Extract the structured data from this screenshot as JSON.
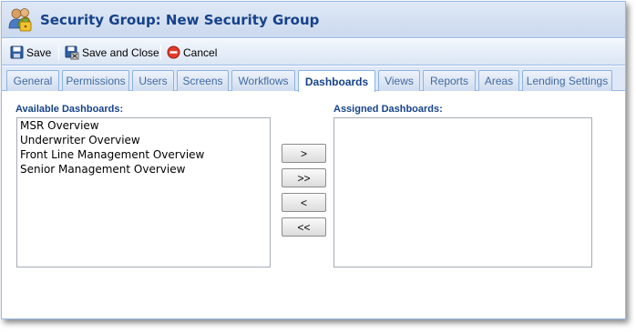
{
  "window": {
    "title": "Security Group: New Security Group",
    "title_icon": "security-group-icon"
  },
  "toolbar": {
    "save_label": "Save",
    "save_close_label": "Save and Close",
    "cancel_label": "Cancel"
  },
  "tabs": [
    {
      "label": "General"
    },
    {
      "label": "Permissions"
    },
    {
      "label": "Users"
    },
    {
      "label": "Screens"
    },
    {
      "label": "Workflows"
    },
    {
      "label": "Dashboards",
      "active": true
    },
    {
      "label": "Views"
    },
    {
      "label": "Reports"
    },
    {
      "label": "Areas"
    },
    {
      "label": "Lending Settings"
    }
  ],
  "available": {
    "label": "Available Dashboards:",
    "items": [
      "MSR Overview",
      "Underwriter Overview",
      "Front Line Management Overview",
      "Senior Management Overview"
    ]
  },
  "assigned": {
    "label": "Assigned Dashboards:",
    "items": []
  },
  "move_buttons": {
    "add_one": ">",
    "add_all": ">>",
    "remove_one": "<",
    "remove_all": "<<"
  },
  "colors": {
    "header_text": "#15428b",
    "border": "#99bbe8",
    "panel_bg": "#dfe8f6"
  }
}
